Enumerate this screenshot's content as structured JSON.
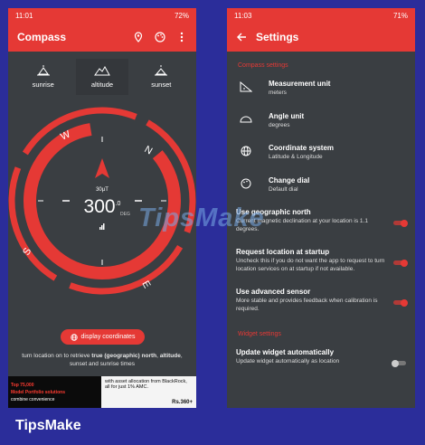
{
  "left": {
    "status": {
      "time": "11:01",
      "battery": "72%"
    },
    "appbar": {
      "title": "Compass"
    },
    "modes": [
      {
        "label": "sunrise"
      },
      {
        "label": "altitude"
      },
      {
        "label": "sunset"
      }
    ],
    "compass": {
      "field_strength": "30µT",
      "heading": "300",
      "heading_decimal": ".0",
      "unit": "DEG",
      "cardinals": {
        "north": "N",
        "east": "E",
        "south": "S",
        "west": "W"
      }
    },
    "display_button": "display coordinates",
    "hint": {
      "prefix": "turn location on to retrieve ",
      "bold1": "true (geographic) north",
      "middle": ", ",
      "bold2": "altitude",
      "suffix": ", sunset and sunrise times"
    },
    "ad": {
      "left_line1": "Top 75,000",
      "left_line2": "Model Portfolio solutions",
      "left_line3": "combine convenience",
      "right_text": "with asset allocation from BlackRock, all for just 1% AMC.",
      "brand": "Rs.360+"
    }
  },
  "right": {
    "status": {
      "time": "11:03",
      "battery": "71%"
    },
    "appbar": {
      "title": "Settings"
    },
    "section1": "Compass settings",
    "settings": [
      {
        "name": "Measurement unit",
        "desc": "meters"
      },
      {
        "name": "Angle unit",
        "desc": "degrees"
      },
      {
        "name": "Coordinate system",
        "desc": "Latitude & Longitude"
      },
      {
        "name": "Change dial",
        "desc": "Default dial"
      }
    ],
    "toggles": [
      {
        "name": "Use geographic north",
        "desc": "Current magnetic declination at your location is 1.1 degrees.",
        "on": true
      },
      {
        "name": "Request location at startup",
        "desc": "Uncheck this if you do not want the app to request to turn location services on at startup if not available.",
        "on": true
      },
      {
        "name": "Use advanced sensor",
        "desc": "More stable and provides feedback when calibration is required.",
        "on": true
      }
    ],
    "section2": "Widget settings",
    "widget_toggle": {
      "name": "Update widget automatically",
      "desc": "Update widget automatically as location",
      "on": false
    }
  },
  "watermark": "TipsMake",
  "footer_brand": "TipsMake",
  "colors": {
    "accent": "#e53935",
    "background": "#3a3e42",
    "frame": "#2b2d9a"
  }
}
